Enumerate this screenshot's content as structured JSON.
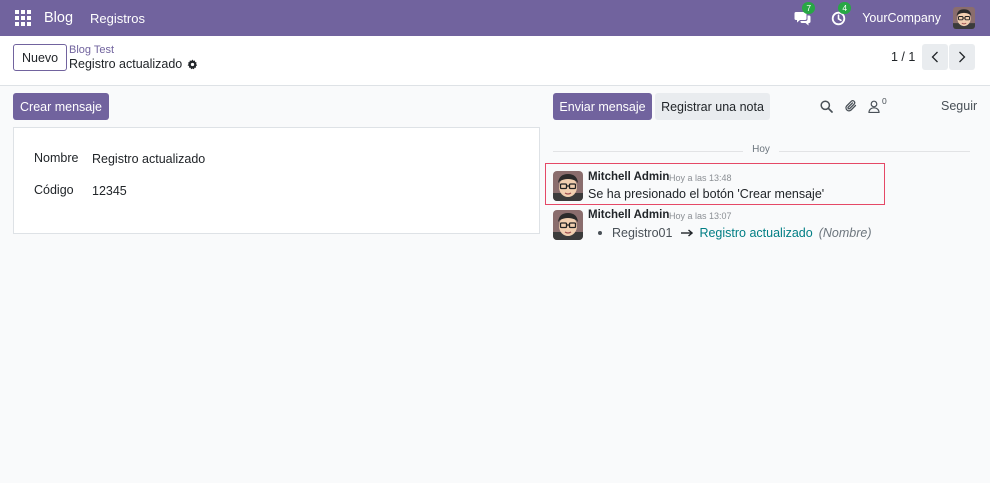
{
  "navbar": {
    "brand": "Blog",
    "menu": "Registros",
    "messages_badge": "7",
    "activities_badge": "4",
    "company": "YourCompany",
    "color": "#71639e"
  },
  "control_panel": {
    "new_button": "Nuevo",
    "breadcrumb_parent": "Blog Test",
    "breadcrumb_current": "Registro actualizado",
    "pager_value": "1 / 1"
  },
  "form": {
    "action_button": "Crear mensaje",
    "fields": [
      {
        "label": "Nombre",
        "value": "Registro actualizado"
      },
      {
        "label": "Código",
        "value": "12345"
      }
    ]
  },
  "chatter": {
    "send_message": "Enviar mensaje",
    "log_note": "Registrar una nota",
    "followers_count": "0",
    "follow": "Seguir",
    "date_separator": "Hoy",
    "messages": [
      {
        "author": "Mitchell Admin",
        "date": "Hoy a las 13:48",
        "body": "Se ha presionado el botón 'Crear mensaje'"
      },
      {
        "author": "Mitchell Admin",
        "date": "Hoy a las 13:07",
        "tracking": {
          "old": "Registro01",
          "new": "Registro actualizado",
          "field": "(Nombre)"
        }
      }
    ]
  },
  "icons": [
    "apps-grid-icon",
    "chat-bubbles-icon",
    "clock-activity-icon",
    "gear-icon",
    "chevron-left-icon",
    "chevron-right-icon",
    "search-icon",
    "paperclip-icon",
    "user-icon",
    "arrow-right-icon"
  ]
}
